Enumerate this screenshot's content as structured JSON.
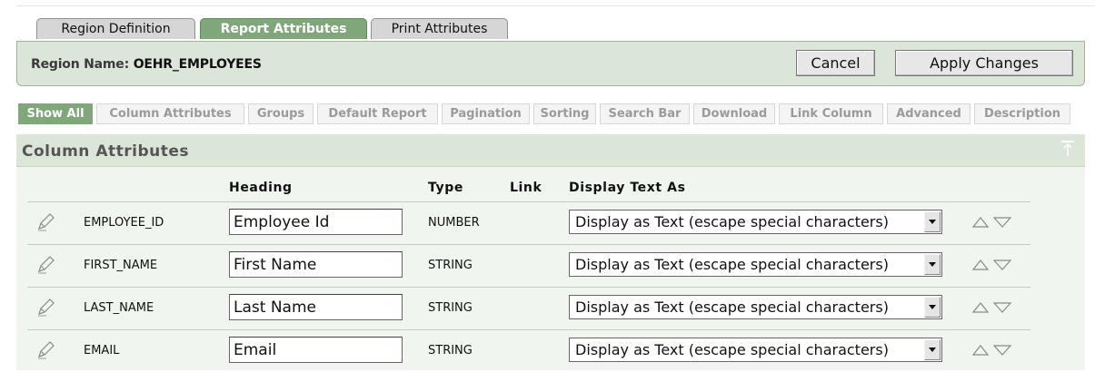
{
  "tabs": [
    "Region Definition",
    "Report Attributes",
    "Print Attributes"
  ],
  "region": {
    "label": "Region Name:",
    "value": "OEHR_EMPLOYEES"
  },
  "buttons": {
    "cancel": "Cancel",
    "apply": "Apply Changes"
  },
  "subnav": [
    "Show All",
    "Column Attributes",
    "Groups",
    "Default Report",
    "Pagination",
    "Sorting",
    "Search Bar",
    "Download",
    "Link Column",
    "Advanced",
    "Description"
  ],
  "panel": {
    "title": "Column Attributes"
  },
  "columns": {
    "heading": "Heading",
    "type": "Type",
    "link": "Link",
    "display": "Display Text As"
  },
  "rows": [
    {
      "name": "EMPLOYEE_ID",
      "heading": "Employee Id",
      "type": "NUMBER",
      "display": "Display as Text (escape special characters)"
    },
    {
      "name": "FIRST_NAME",
      "heading": "First Name",
      "type": "STRING",
      "display": "Display as Text (escape special characters)"
    },
    {
      "name": "LAST_NAME",
      "heading": "Last Name",
      "type": "STRING",
      "display": "Display as Text (escape special characters)"
    },
    {
      "name": "EMAIL",
      "heading": "Email",
      "type": "STRING",
      "display": "Display as Text (escape special characters)"
    }
  ],
  "icons": {
    "edit": "edit-pencil-icon",
    "move_up": "move-up-icon",
    "move_down": "move-down-icon",
    "top": "back-to-top-icon"
  },
  "colors": {
    "accent": "#7fa77a",
    "panel": "#dbe6d8"
  }
}
